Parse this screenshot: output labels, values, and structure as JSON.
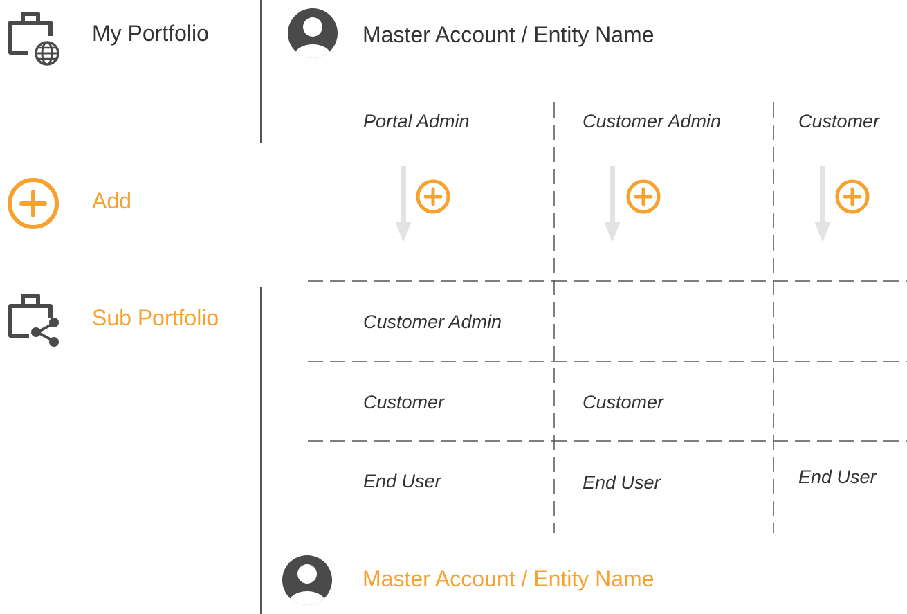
{
  "colors": {
    "accent": "#F7A12E",
    "text": "#333333",
    "icon": "#4A4A4A",
    "divider": "#555555",
    "arrow": "#E3E3E3"
  },
  "legend": {
    "my_portfolio": {
      "label": "My Portfolio",
      "icon": "briefcase-globe-icon"
    },
    "add": {
      "label": "Add",
      "icon": "plus-circle-icon"
    },
    "sub_portfolio": {
      "label": "Sub Portfolio",
      "icon": "briefcase-share-icon"
    }
  },
  "top_account": {
    "name": "Master Account / Entity Name",
    "icon": "user-avatar-icon"
  },
  "bottom_account": {
    "name": "Master Account / Entity Name",
    "icon": "user-avatar-icon"
  },
  "grid": {
    "columns": [
      "Portal Admin",
      "Customer Admin",
      "Customer"
    ],
    "rows": [
      [
        "Customer Admin",
        "",
        ""
      ],
      [
        "Customer",
        "Customer",
        ""
      ],
      [
        "End User",
        "End User",
        "End User"
      ]
    ]
  }
}
